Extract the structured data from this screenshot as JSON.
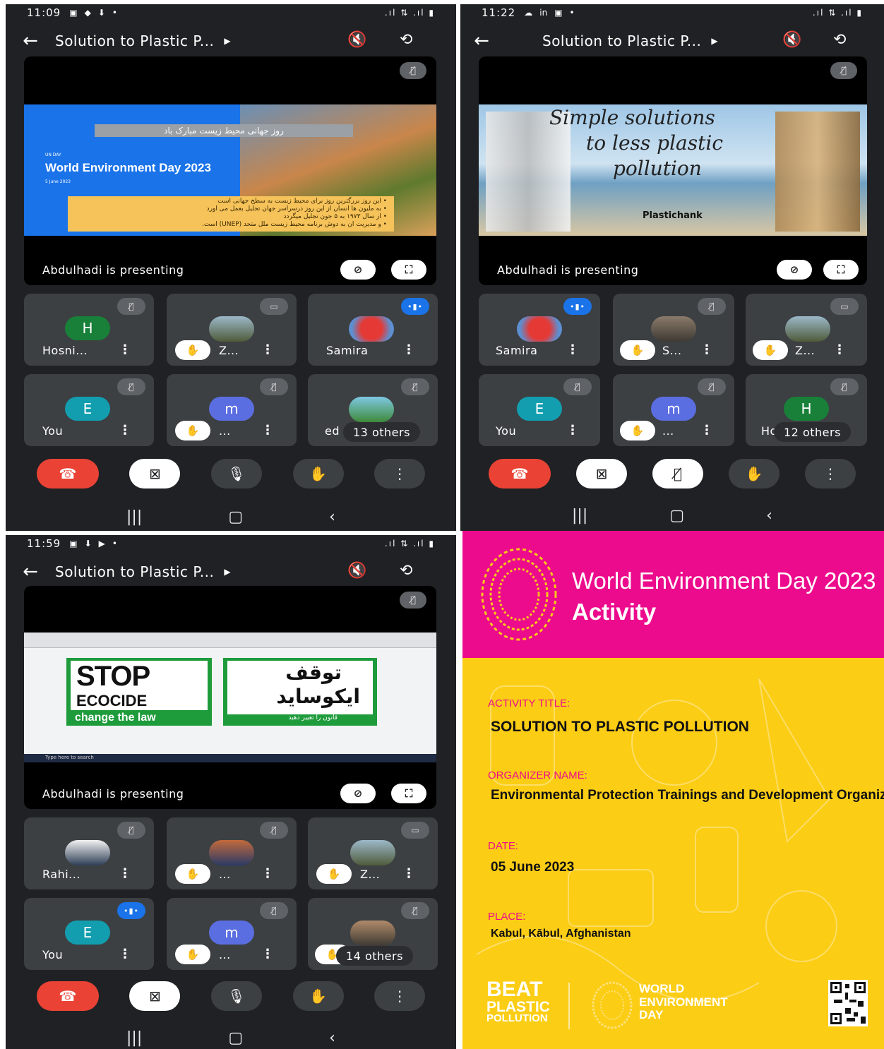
{
  "phones": [
    {
      "time": "11:09",
      "meeting_title": "Solution to Plastic P...",
      "presenting": "Abdulhadi is presenting",
      "slide": {
        "banner_fa": "روز جهانی محیط زیست مبارک باد",
        "small": "UN DAY",
        "title": "World Environment Day 2023",
        "date": "5 June 2023",
        "bullets": [
          "• این روز بزرگترین روز برای محیط زیست به سطح جهانی است",
          "• به ملیون ها انسان از این روز درسراسر جهان تجلیل بعمل می اورد",
          "• از سال ۱۹۷۳ به ۵ جون تجلیل میگردد",
          "• و مدیریت ان به دوش برنامه محیط زیست ملل متحد (UNEP) است."
        ]
      },
      "tiles": [
        {
          "name": "Hosni...",
          "avatar": "H",
          "color": "#188038"
        },
        {
          "name": "Z...",
          "avatar": "",
          "color": ""
        },
        {
          "name": "Samira",
          "avatar": "",
          "color": ""
        },
        {
          "name": "You",
          "avatar": "E",
          "color": "#129eaf"
        },
        {
          "name": "...",
          "avatar": "m",
          "color": "#5b6ee1"
        },
        {
          "name": "ed",
          "avatar": "",
          "color": "",
          "others": "13 others"
        }
      ]
    },
    {
      "time": "11:22",
      "meeting_title": "Solution to Plastic P...",
      "presenting": "Abdulhadi is presenting",
      "slide": {
        "line1": "Simple solutions",
        "line2": "to less plastic",
        "line3": "pollution",
        "brand": "Plastichank"
      },
      "tiles": [
        {
          "name": "Samira",
          "avatar": "",
          "color": ""
        },
        {
          "name": "S...",
          "avatar": "",
          "color": ""
        },
        {
          "name": "Z...",
          "avatar": "",
          "color": ""
        },
        {
          "name": "You",
          "avatar": "E",
          "color": "#129eaf"
        },
        {
          "name": "...",
          "avatar": "m",
          "color": "#5b6ee1"
        },
        {
          "name": "Ho",
          "avatar": "H",
          "color": "#188038",
          "others": "12 others"
        }
      ]
    },
    {
      "time": "11:59",
      "meeting_title": "Solution to Plastic P...",
      "presenting": "Abdulhadi is presenting",
      "slide": {
        "stop": "STOP",
        "ecocide": "ECOCIDE",
        "law": "change the law",
        "fa1": "توقف",
        "fa2": "ایکوساید",
        "fa3": "قانون را تغییر دهید",
        "taskbar_search": "Type here to search"
      },
      "tiles": [
        {
          "name": "Rahi...",
          "avatar": "",
          "color": ""
        },
        {
          "name": "...",
          "avatar": "",
          "color": ""
        },
        {
          "name": "Z...",
          "avatar": "",
          "color": ""
        },
        {
          "name": "You",
          "avatar": "E",
          "color": "#129eaf"
        },
        {
          "name": "...",
          "avatar": "m",
          "color": "#5b6ee1"
        },
        {
          "name": "",
          "avatar": "",
          "color": "",
          "others": "14 others"
        }
      ]
    }
  ],
  "poster": {
    "header_line1": "World Environment Day 2023",
    "header_line2": "Activity",
    "activity_label": "ACTIVITY TITLE:",
    "activity_value": "SOLUTION TO PLASTIC POLLUTION",
    "organizer_label": "ORGANIZER NAME:",
    "organizer_value": "Environmental Protection Trainings and Development Organiza",
    "date_label": "DATE:",
    "date_value": "05 June 2023",
    "place_label": "PLACE:",
    "place_value": "Kabul, Kābul, Afghanistan",
    "beat1": "BEAT",
    "beat2": "PLASTIC",
    "beat3": "POLLUTION",
    "wed1": "WORLD",
    "wed2": "ENVIRONMENT",
    "wed3": "DAY",
    "colors": {
      "magenta": "#ec0b8c",
      "yellow": "#fccd15"
    }
  },
  "icons": {
    "back": "arrow-left-icon",
    "audio": "speaker-off-icon",
    "camera_switch": "camera-flip-icon",
    "end_call": "phone-hangup-icon",
    "video_off": "video-off-icon",
    "mic": "mic-icon",
    "raise_hand": "hand-icon",
    "more": "more-vert-icon"
  }
}
